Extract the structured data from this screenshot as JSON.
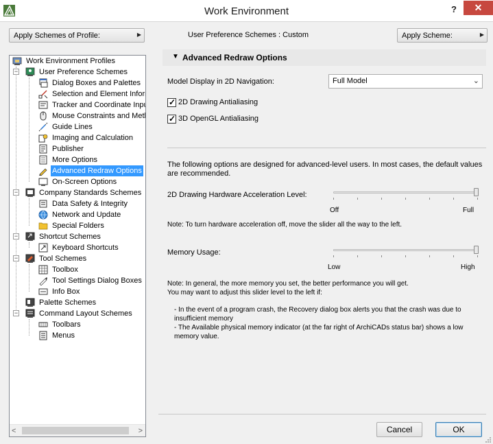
{
  "window": {
    "title": "Work Environment",
    "help_label": "?",
    "close_label": "✕"
  },
  "toolbar": {
    "apply_profile_label": "Apply Schemes of Profile:",
    "scheme_info": "User Preference Schemes : Custom",
    "apply_scheme_label": "Apply Scheme:"
  },
  "tree": {
    "items": [
      {
        "label": "Work Environment Profiles",
        "level": 0
      },
      {
        "label": "User Preference Schemes",
        "level": 1
      },
      {
        "label": "Dialog Boxes and Palettes",
        "level": 2
      },
      {
        "label": "Selection and Element Inform",
        "level": 2
      },
      {
        "label": "Tracker and Coordinate Inpu",
        "level": 2
      },
      {
        "label": "Mouse Constraints and Meth",
        "level": 2
      },
      {
        "label": "Guide Lines",
        "level": 2
      },
      {
        "label": "Imaging and Calculation",
        "level": 2
      },
      {
        "label": "Publisher",
        "level": 2
      },
      {
        "label": "More Options",
        "level": 2
      },
      {
        "label": "Advanced Redraw Options",
        "level": 2,
        "selected": true
      },
      {
        "label": "On-Screen Options",
        "level": 2
      },
      {
        "label": "Company Standards Schemes",
        "level": 1
      },
      {
        "label": "Data Safety & Integrity",
        "level": 2
      },
      {
        "label": "Network and Update",
        "level": 2
      },
      {
        "label": "Special Folders",
        "level": 2
      },
      {
        "label": "Shortcut Schemes",
        "level": 1
      },
      {
        "label": "Keyboard Shortcuts",
        "level": 2
      },
      {
        "label": "Tool Schemes",
        "level": 1
      },
      {
        "label": "Toolbox",
        "level": 2
      },
      {
        "label": "Tool Settings Dialog Boxes",
        "level": 2
      },
      {
        "label": "Info Box",
        "level": 2
      },
      {
        "label": "Palette Schemes",
        "level": 1
      },
      {
        "label": "Command Layout Schemes",
        "level": 1
      },
      {
        "label": "Toolbars",
        "level": 2
      },
      {
        "label": "Menus",
        "level": 2
      }
    ]
  },
  "panel": {
    "section_title": "Advanced Redraw Options",
    "model_display_label": "Model Display in 2D Navigation:",
    "model_display_value": "Full Model",
    "aa2d_label": "2D Drawing Antialiasing",
    "aa2d_checked": true,
    "aa3d_label": "3D OpenGL Antialiasing",
    "aa3d_checked": true,
    "intro_text": "The following options are designed for advanced-level users. In most cases, the default values are recommended.",
    "hw_label": "2D Drawing Hardware Acceleration Level:",
    "hw_min": "Off",
    "hw_max": "Full",
    "hw_level": 1.0,
    "hw_note": "Note: To turn hardware acceleration off, move the slider all the way to the left.",
    "mem_label": "Memory Usage:",
    "mem_min": "Low",
    "mem_max": "High",
    "mem_level": 1.0,
    "mem_note_1": "Note: In general, the more memory you set, the better performance you will get.",
    "mem_note_2": "You may want to adjust this slider level to the left if:",
    "mem_bullet_1": "- In the event of a program crash, the Recovery dialog box alerts you that the crash was due to insufficient memory",
    "mem_bullet_2": "- The Available physical memory indicator (at the far right of ArchiCADs status bar) shows a low memory value."
  },
  "footer": {
    "cancel_label": "Cancel",
    "ok_label": "OK"
  },
  "colors": {
    "selection": "#3399ff",
    "close_button": "#c7483f",
    "section_header": "#e8e8e8"
  }
}
